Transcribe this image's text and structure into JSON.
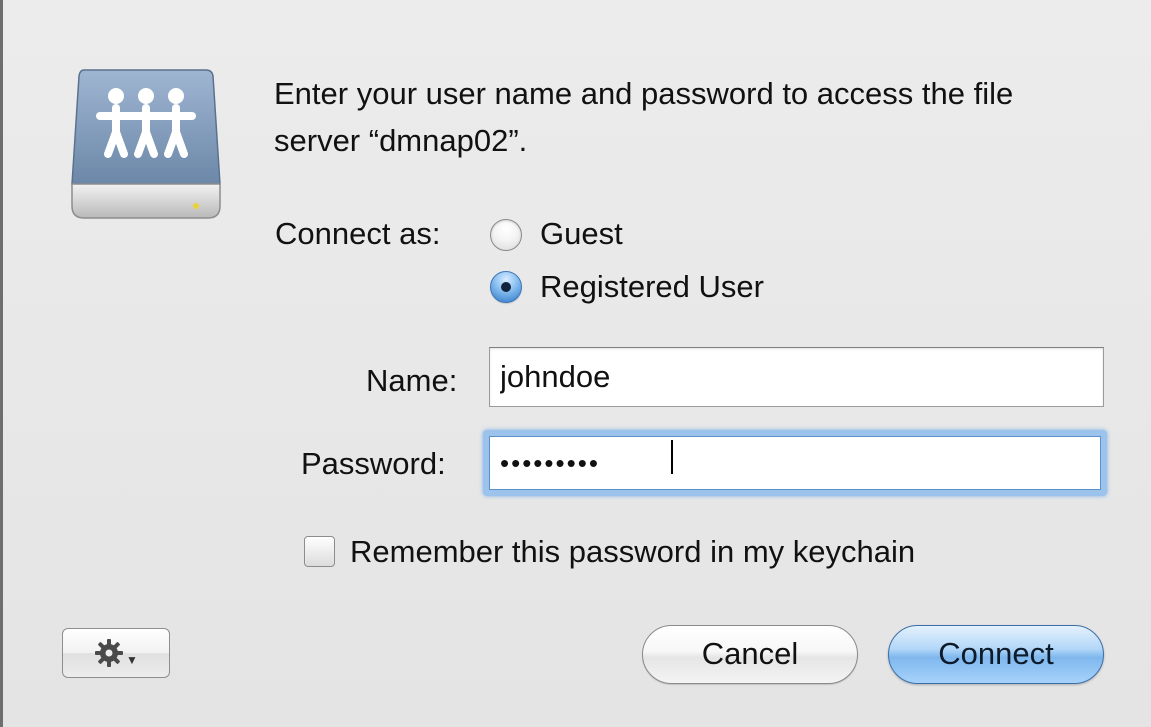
{
  "dialog": {
    "message": "Enter your user name and password to access the file server “dmnap02”.",
    "icon": "shared-server-icon"
  },
  "connect_as": {
    "label": "Connect as:",
    "options": [
      {
        "label": "Guest",
        "selected": false
      },
      {
        "label": "Registered User",
        "selected": true
      }
    ]
  },
  "fields": {
    "name_label": "Name:",
    "name_value": "johndoe",
    "password_label": "Password:",
    "password_value": "•••••••••"
  },
  "remember": {
    "label": "Remember this password in my keychain",
    "checked": false
  },
  "buttons": {
    "action_menu_icon": "gear-icon",
    "cancel": "Cancel",
    "connect": "Connect"
  },
  "colors": {
    "default_button": "#7fb8ee",
    "focus_ring": "#9cc3ec",
    "dialog_background": "#e7e7e7"
  }
}
